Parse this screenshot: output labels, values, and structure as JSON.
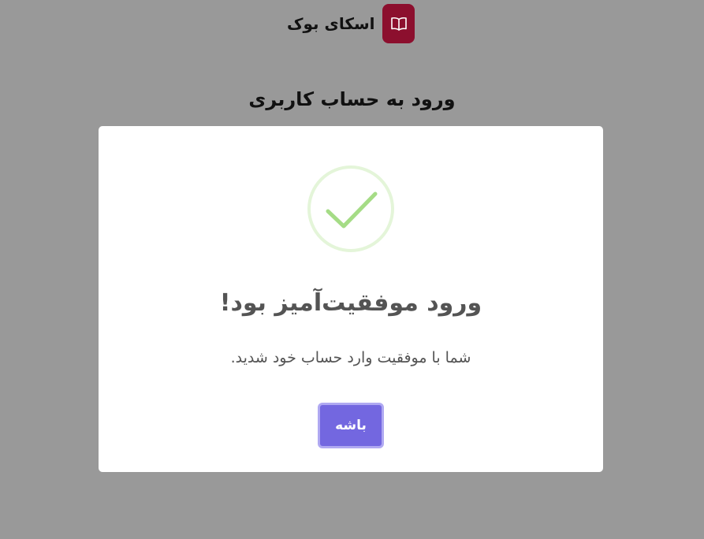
{
  "header": {
    "brand_name": "اسکای بوک",
    "logo_icon": "open-book-icon",
    "logo_color": "#8c0f2e"
  },
  "page": {
    "heading": "ورود به حساب کاربری"
  },
  "modal": {
    "icon": "success-check-icon",
    "icon_color": "#a5dc86",
    "title": "ورود موفقیت‌آمیز بود!",
    "text": "شما با موفقیت وارد حساب خود شدید.",
    "confirm_label": "باشه",
    "confirm_color": "#7367e0"
  }
}
